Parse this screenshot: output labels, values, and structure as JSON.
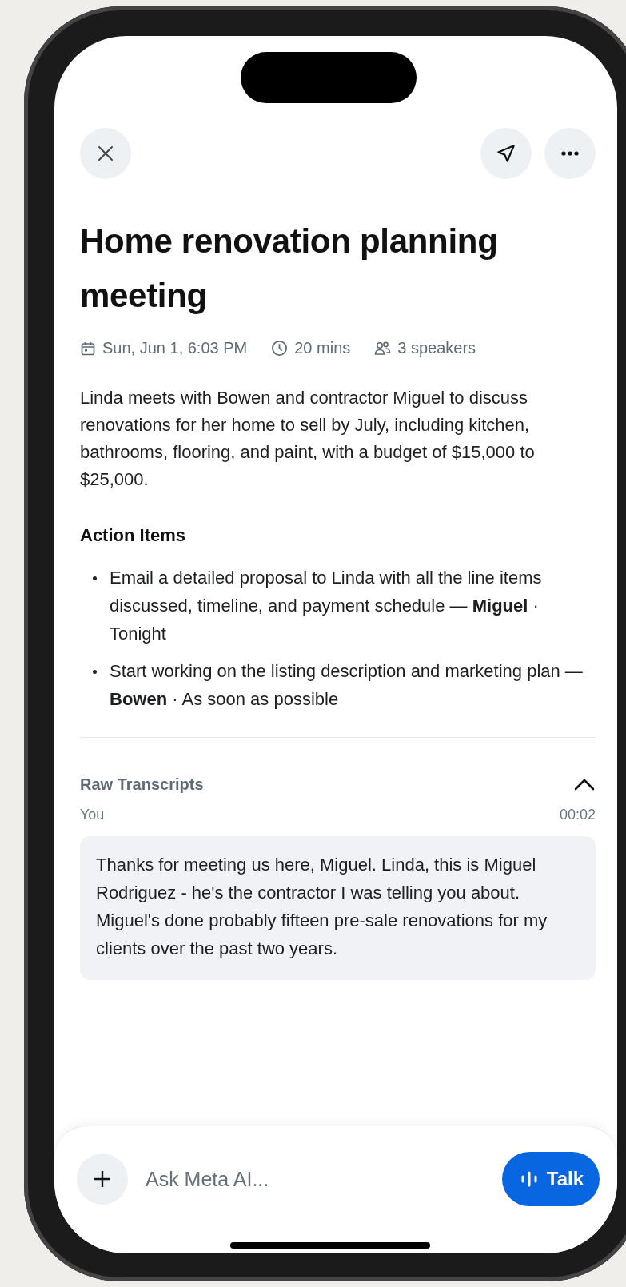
{
  "title": "Home renovation planning meeting",
  "meta": {
    "date": "Sun, Jun 1, 6:03 PM",
    "duration": "20 mins",
    "speakers": "3 speakers"
  },
  "summary": "Linda meets with Bowen and contractor Miguel to discuss renovations for her home to sell by July, including kitchen, bathrooms, flooring, and paint, with a budget of $15,000 to $25,000.",
  "action_items": {
    "heading": "Action Items",
    "items": [
      {
        "text": "Email a detailed proposal to Linda with all the line items discussed, timeline, and payment schedule — **Miguel** · Tonight"
      },
      {
        "text": "Start working on the listing description and marketing plan — **Bowen** · As soon as possible"
      }
    ]
  },
  "transcripts": {
    "heading": "Raw Transcripts",
    "expanded": true,
    "entries": [
      {
        "speaker": "You",
        "time": "00:02",
        "text": "Thanks for meeting us here, Miguel. Linda, this is Miguel Rodriguez - he's the contractor I was telling you about. Miguel's done probably fifteen pre-sale renovations for my clients over the past two years."
      }
    ]
  },
  "composer": {
    "placeholder": "Ask Meta AI...",
    "talk_button": "Talk"
  }
}
